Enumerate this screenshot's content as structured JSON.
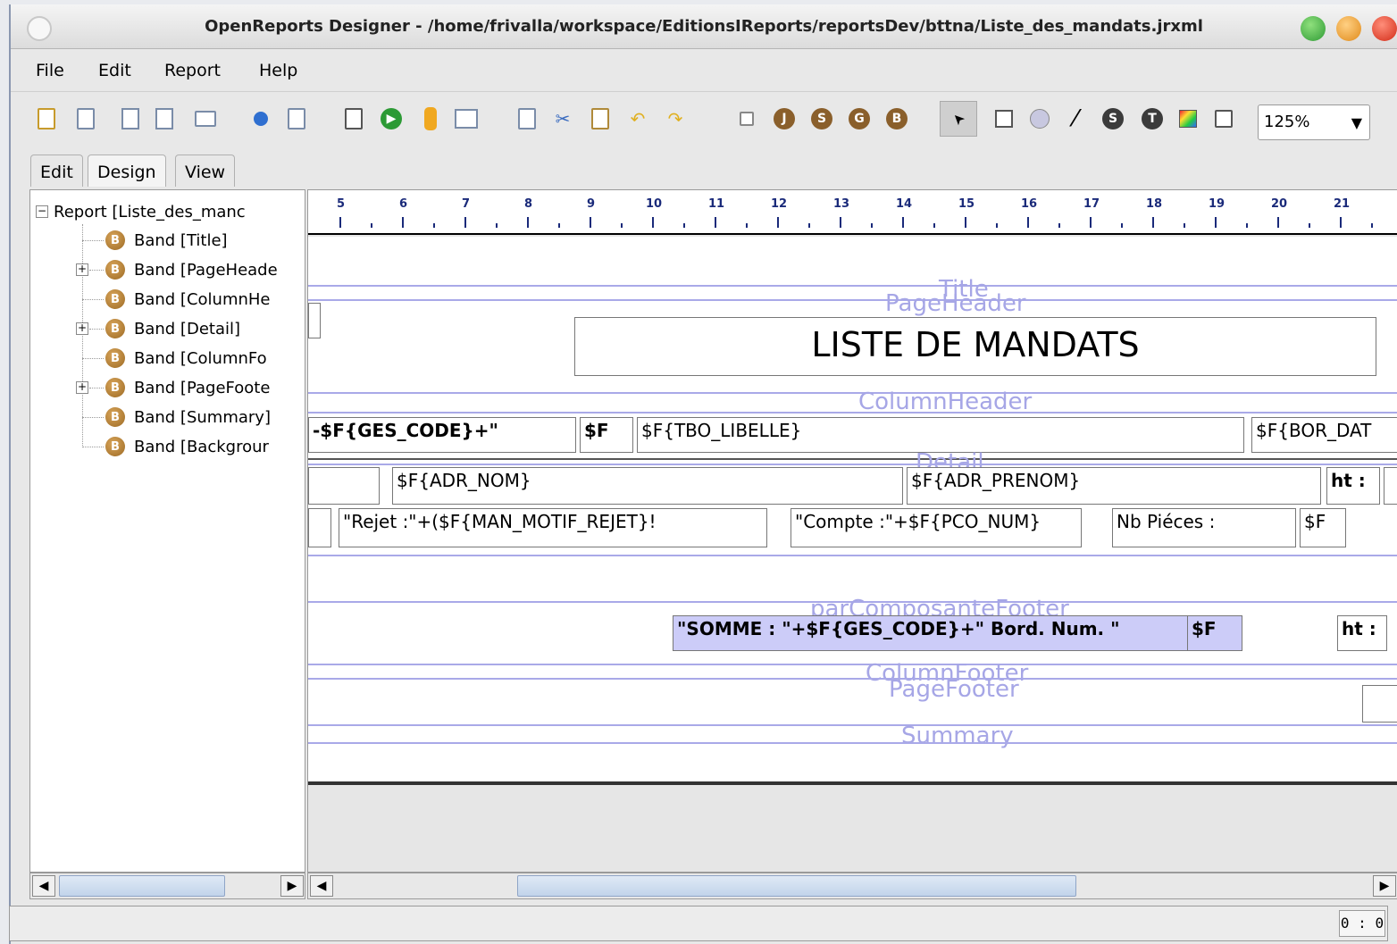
{
  "window": {
    "title": "OpenReports Designer - /home/frivalla/workspace/EditionsIReports/reportsDev/bttna/Liste_des_mandats.jrxml",
    "buttons": {
      "minimize_color": "#3bb34a",
      "maximize_color": "#f2a33a",
      "close_color": "#e3452f"
    }
  },
  "menubar": {
    "items": [
      "File",
      "Edit",
      "Report",
      "Help"
    ]
  },
  "toolbar": {
    "zoom": "125%",
    "zoom_arrow": "▼",
    "icons": [
      "new-document-icon",
      "open-document-icon",
      "save-icon",
      "save-all-icon",
      "print-icon",
      "blue-dot-icon",
      "compile-icon",
      "wizard-icon",
      "run-icon",
      "datasource-icon",
      "table-icon",
      "copy-icon",
      "cut-icon",
      "paste-icon",
      "undo-icon",
      "redo-icon",
      "structure-icon",
      "band-j-icon",
      "band-s-icon",
      "band-g-icon",
      "band-b-icon",
      "pointer-icon",
      "rectangle-icon",
      "ellipse-icon",
      "line-icon",
      "subreport-icon",
      "text-icon",
      "image-icon",
      "frame-icon"
    ],
    "glyphs": {
      "j": "J",
      "s": "S",
      "g": "G",
      "b": "B",
      "t": "T",
      "pointer": "➤",
      "line": "⁄"
    }
  },
  "tabs": [
    "Edit",
    "Design",
    "View"
  ],
  "tree": {
    "root": "Report [Liste_des_manc",
    "root_expander": "−",
    "node_expander": "+",
    "badge": "B",
    "nodes": [
      {
        "label": "Band [Title]",
        "expandable": false
      },
      {
        "label": "Band [PageHeade",
        "expandable": true
      },
      {
        "label": "Band [ColumnHe",
        "expandable": false
      },
      {
        "label": "Band [Detail]",
        "expandable": true
      },
      {
        "label": "Band [ColumnFo",
        "expandable": false
      },
      {
        "label": "Band [PageFoote",
        "expandable": true
      },
      {
        "label": "Band [Summary]",
        "expandable": false
      },
      {
        "label": "Band [Backgrour",
        "expandable": false
      }
    ]
  },
  "ruler": {
    "numbers": [
      "5",
      "6",
      "7",
      "8",
      "9",
      "10",
      "11",
      "12",
      "13",
      "14",
      "15",
      "16",
      "17",
      "18",
      "19",
      "20",
      "21"
    ]
  },
  "bands": {
    "title": "Title",
    "page_header": "PageHeader",
    "column_header": "ColumnHeader",
    "detail": "Detail",
    "group_footer": "parComposanteFooter",
    "column_footer": "ColumnFooter",
    "page_footer": "PageFooter",
    "summary": "Summary"
  },
  "fields": {
    "report_title": "LISTE DE MANDATS",
    "ges_code": "-$F{GES_CODE}+\"",
    "f_short": "$F",
    "tbo_libelle": "$F{TBO_LIBELLE}",
    "bor_date": "$F{BOR_DAT",
    "adr_nom": "$F{ADR_NOM}",
    "adr_prenom": "$F{ADR_PRENOM}",
    "ht": "ht :",
    "rejet": "\"Rejet :\"+($F{MAN_MOTIF_REJET}!",
    "compte": "\"Compte :\"+$F{PCO_NUM}",
    "nb_pieces": "Nb Piéces :",
    "f_short2": "$F",
    "somme": "\"SOMME : \"+$F{GES_CODE}+\" Bord. Num. \"",
    "f_short3": "$F",
    "ht2": "ht :"
  },
  "scroll": {
    "left": "◀",
    "right": "▶"
  },
  "status": {
    "coords": "0 : 0"
  },
  "colors": {
    "band_line": "#a9a9e8",
    "band_label": "#a6a6e6",
    "highlight_field": "#ccccf8"
  }
}
